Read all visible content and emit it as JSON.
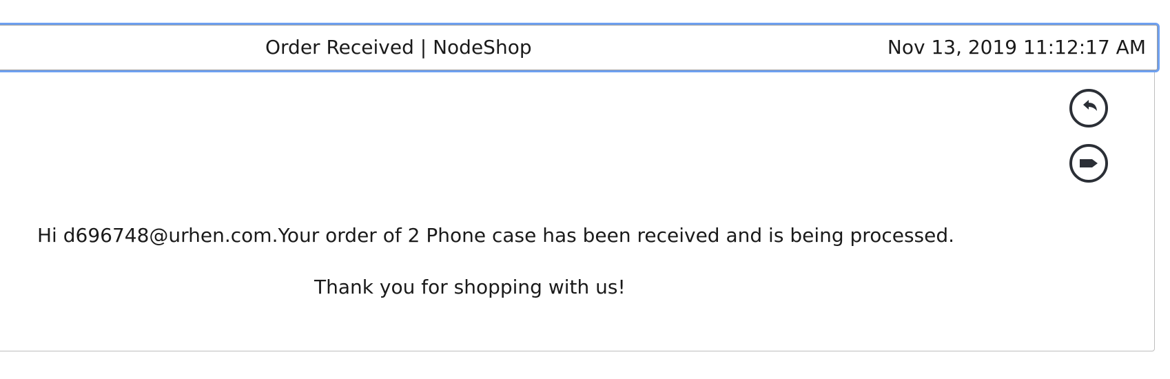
{
  "email": {
    "subject": "Order Received | NodeShop",
    "timestamp": "Nov 13, 2019 11:12:17 AM",
    "body": {
      "message": "Hi d696748@urhen.com.Your order of 2 Phone case has been received and is being processed.",
      "thanks": "Thank you for shopping with us!"
    },
    "actions": [
      {
        "icon": "reply-icon"
      },
      {
        "icon": "label-icon"
      }
    ]
  },
  "colors": {
    "focus_ring": "#6ea0f0",
    "icon": "#2b2f36",
    "border": "#bdbdbd"
  }
}
